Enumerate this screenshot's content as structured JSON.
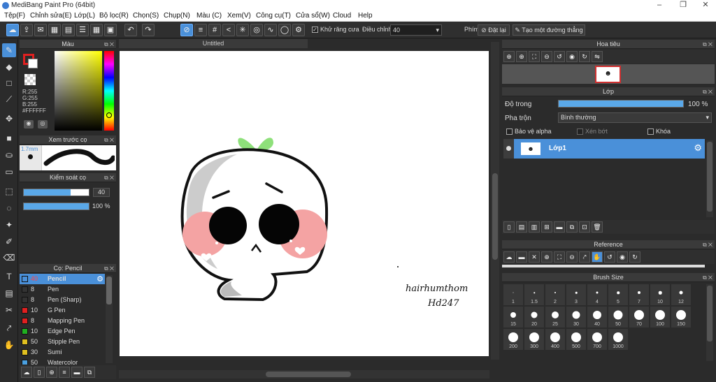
{
  "window": {
    "title": "MediBang Paint Pro (64bit)"
  },
  "menu": [
    "Tệp(F)",
    "Chỉnh sửa(E)",
    "Lớp(L)",
    "Bộ lọc(R)",
    "Chọn(S)",
    "Chụp(N)",
    "Màu (C)",
    "Xem(V)",
    "Công cụ(T)",
    "Cửa sổ(W)",
    "Cloud",
    "Help"
  ],
  "toolbar": {
    "antialias_label": "Khử răng cưa",
    "adjust_label": "Điều chỉnh",
    "adjust_value": "40",
    "key_label": "Phím",
    "reset_label": "Đặt lại",
    "line_label": "Tạo một đường thẳng"
  },
  "color_panel": {
    "title": "Màu",
    "r": "R:255",
    "g": "G:255",
    "b": "B:255",
    "hex": "#FFFFFF",
    "fg": "#e02020",
    "bg": "#ffffff"
  },
  "preview_panel": {
    "title": "Xem trước cọ",
    "size": "1.7mm"
  },
  "brush_control": {
    "title": "Kiểm soát cọ",
    "size": "40",
    "size_fill": 0.72,
    "opacity": "100 %",
    "opacity_fill": 1.0
  },
  "brush_list": {
    "title": "Cọ: Pencil",
    "items": [
      {
        "size": "40",
        "name": "Pencil",
        "color": "#4a90d9",
        "selected": true
      },
      {
        "size": "8",
        "name": "Pen",
        "color": "#333333"
      },
      {
        "size": "8",
        "name": "Pen (Sharp)",
        "color": "#333333"
      },
      {
        "size": "10",
        "name": "G Pen",
        "color": "#e02020"
      },
      {
        "size": "8",
        "name": "Mapping Pen",
        "color": "#e02020"
      },
      {
        "size": "10",
        "name": "Edge Pen",
        "color": "#20b020"
      },
      {
        "size": "50",
        "name": "Stipple Pen",
        "color": "#e0c020"
      },
      {
        "size": "30",
        "name": "Sumi",
        "color": "#e0c020"
      },
      {
        "size": "50",
        "name": "Watercolor",
        "color": "#4aa0e0"
      }
    ]
  },
  "canvas": {
    "tab": "Untitled",
    "signature_line1": "hairhumthom",
    "signature_line2": "Hd247"
  },
  "navigator": {
    "title": "Hoa tiêu"
  },
  "layer_panel": {
    "title": "Lớp",
    "opacity_label": "Độ trong",
    "opacity_value": "100 %",
    "blend_label": "Pha trộn",
    "blend_value": "Bình thường",
    "protect_alpha": "Bảo vệ alpha",
    "clipping": "Xén bớt",
    "lock": "Khóa",
    "layer_name": "Lớp1"
  },
  "reference_panel": {
    "title": "Reference"
  },
  "brush_size_panel": {
    "title": "Brush Size",
    "sizes": [
      "1",
      "1.5",
      "2",
      "3",
      "4",
      "5",
      "7",
      "10",
      "12",
      "15",
      "20",
      "25",
      "30",
      "40",
      "50",
      "70",
      "100",
      "150",
      "200",
      "300",
      "400",
      "500",
      "700",
      "1000"
    ]
  }
}
